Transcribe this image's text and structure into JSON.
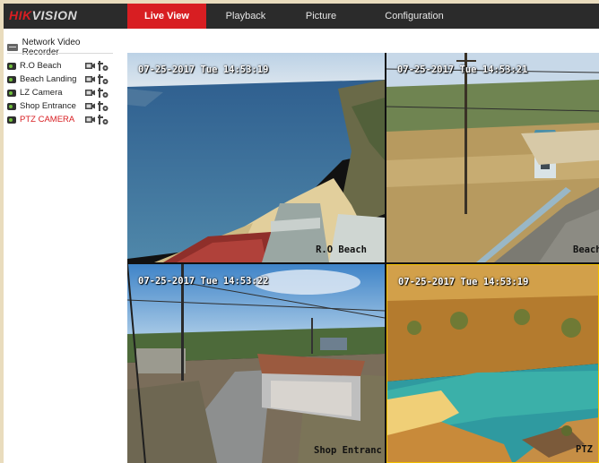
{
  "brand": {
    "part1": "HIK",
    "part2": "VISION",
    "color": "#d81e22"
  },
  "nav": {
    "tabs": [
      {
        "label": "Live View",
        "active": true
      },
      {
        "label": "Playback",
        "active": false
      },
      {
        "label": "Picture",
        "active": false
      },
      {
        "label": "Configuration",
        "active": false
      }
    ]
  },
  "sidebar": {
    "device": "Network Video Recorder",
    "cameras": [
      {
        "name": "R.O Beach",
        "selected": false,
        "icons": [
          "record-icon",
          "ptz-icon"
        ]
      },
      {
        "name": "Beach Landing",
        "selected": false,
        "icons": [
          "record-icon",
          "ptz-icon"
        ]
      },
      {
        "name": "LZ Camera",
        "selected": false,
        "icons": [
          "record-icon",
          "ptz-icon"
        ]
      },
      {
        "name": "Shop Entrance",
        "selected": false,
        "icons": [
          "record-icon",
          "ptz-icon"
        ]
      },
      {
        "name": "PTZ CAMERA",
        "selected": true,
        "icons": [
          "record-icon",
          "ptz-icon"
        ]
      }
    ]
  },
  "feeds": [
    {
      "timestamp": "07-25-2017 Tue 14:53:19",
      "label": "R.O Beach"
    },
    {
      "timestamp": "07-25-2017 Tue 14:53:21",
      "label": "Beach"
    },
    {
      "timestamp": "07-25-2017 Tue 14:53:22",
      "label": "Shop Entranc"
    },
    {
      "timestamp": "07-25-2017 Tue 14:53:19",
      "label": "PTZ C"
    }
  ],
  "colors": {
    "nav_bg": "#2b2b2b",
    "active_tab": "#d81e22",
    "selected_camera_text": "#d81e22",
    "focused_tile_border": "#f0c000",
    "page_bg": "#e9dcbd"
  }
}
